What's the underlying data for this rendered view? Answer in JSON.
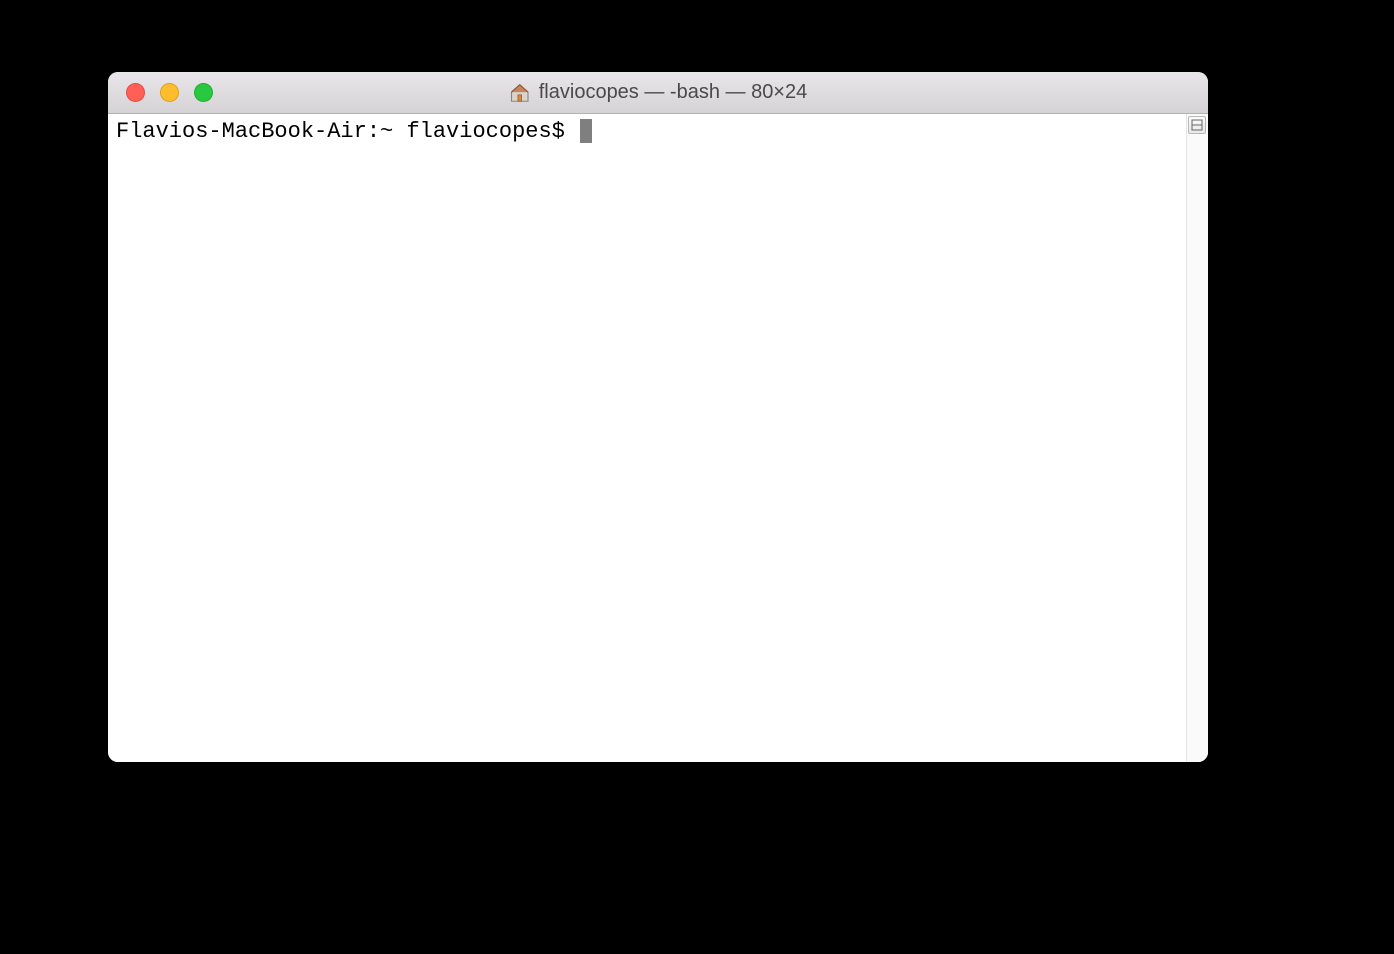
{
  "window": {
    "title": "flaviocopes — -bash — 80×24"
  },
  "terminal": {
    "prompt": "Flavios-MacBook-Air:~ flaviocopes$ "
  }
}
